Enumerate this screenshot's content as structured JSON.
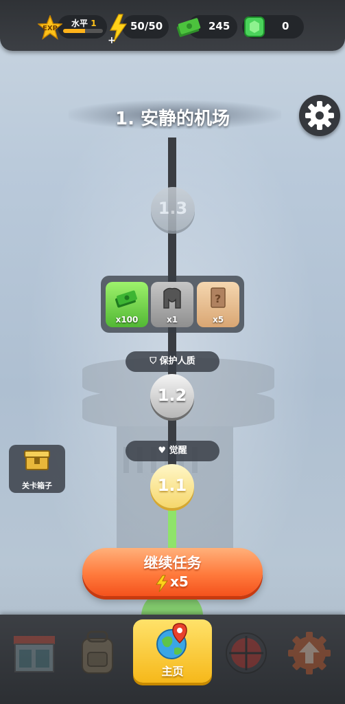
{
  "top_bar": {
    "exp_label": "EXP",
    "level_label": "水平",
    "level_value": "1",
    "level_progress": 0.55,
    "energy": "50/50",
    "cash": "245",
    "gems": "0"
  },
  "stage": {
    "title": "1. 安静的机场"
  },
  "path": {
    "nodes": [
      {
        "label": "1.3",
        "state": "locked"
      },
      {
        "label": "1.2",
        "state": "available"
      },
      {
        "label": "1.1",
        "state": "current"
      }
    ],
    "tags": {
      "hostage": "保护人质",
      "awake": "觉醒"
    },
    "rewards": [
      {
        "icon": "cash-icon",
        "count": "x100"
      },
      {
        "icon": "armor-icon",
        "count": "x1"
      },
      {
        "icon": "mystery-card-icon",
        "count": "x5"
      }
    ]
  },
  "crate": {
    "label": "关卡箱子"
  },
  "continue_button": {
    "label": "继续任务",
    "cost": "x5"
  },
  "bottom_nav": {
    "home_label": "主页",
    "items": [
      "shop-icon",
      "backpack-icon",
      "globe-icon",
      "crosshair-icon",
      "upgrade-icon"
    ]
  },
  "colors": {
    "accent_orange": "#ff7a3c",
    "home_yellow": "#f6b81a",
    "progress_green": "#8fe36a"
  }
}
